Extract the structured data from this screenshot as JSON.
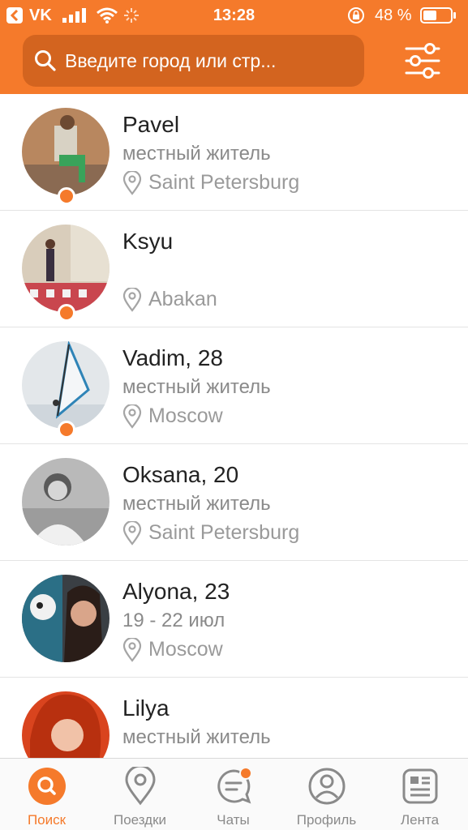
{
  "status_bar": {
    "carrier": "VK",
    "time": "13:28",
    "battery": "48 %"
  },
  "search": {
    "placeholder": "Введите город или стр..."
  },
  "people": [
    {
      "name": "Pavel",
      "subtitle": "местный житель",
      "city": "Saint Petersburg",
      "online": true
    },
    {
      "name": "Ksyu",
      "subtitle": "",
      "city": "Abakan",
      "online": true
    },
    {
      "name": "Vadim, 28",
      "subtitle": "местный житель",
      "city": "Moscow",
      "online": true
    },
    {
      "name": "Oksana, 20",
      "subtitle": "местный житель",
      "city": "Saint Petersburg",
      "online": false
    },
    {
      "name": "Alyona, 23",
      "subtitle": "19 - 22 июл",
      "city": "Moscow",
      "online": false
    },
    {
      "name": "Lilya",
      "subtitle": "местный житель",
      "city": "",
      "online": false
    }
  ],
  "tabs": [
    {
      "label": "Поиск",
      "icon": "search-icon",
      "active": true
    },
    {
      "label": "Поездки",
      "icon": "pin-icon",
      "active": false
    },
    {
      "label": "Чаты",
      "icon": "chat-icon",
      "active": false,
      "badge": true
    },
    {
      "label": "Профиль",
      "icon": "profile-icon",
      "active": false
    },
    {
      "label": "Лента",
      "icon": "feed-icon",
      "active": false
    }
  ],
  "colors": {
    "accent": "#f57a2b",
    "search_bg": "#d3641f"
  }
}
